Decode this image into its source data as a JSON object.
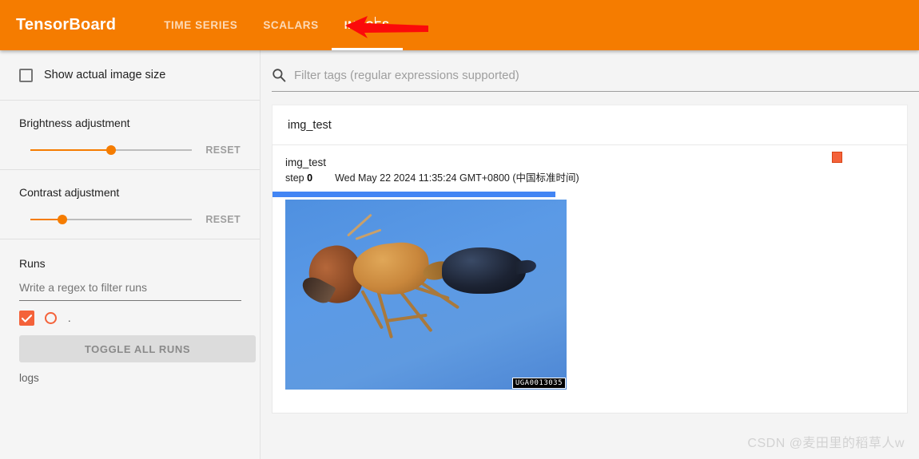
{
  "header": {
    "brand": "TensorBoard",
    "tabs": [
      {
        "label": "TIME SERIES",
        "active": false
      },
      {
        "label": "SCALARS",
        "active": false
      },
      {
        "label": "IMAGES",
        "active": true
      }
    ],
    "annotation": "red-left-arrow",
    "background_color": "#f57c00"
  },
  "sidebar": {
    "show_actual_image_size": {
      "label": "Show actual image size",
      "checked": false
    },
    "brightness": {
      "title": "Brightness adjustment",
      "reset_label": "RESET",
      "value_percent": 50
    },
    "contrast": {
      "title": "Contrast adjustment",
      "reset_label": "RESET",
      "value_percent": 20
    },
    "runs": {
      "title": "Runs",
      "filter_placeholder": "Write a regex to filter runs",
      "filter_value": "",
      "run_items": [
        {
          "label": ".",
          "checked": true,
          "color": "#f4623a"
        }
      ],
      "toggle_all_label": "TOGGLE ALL RUNS",
      "footer_label": "logs"
    }
  },
  "main": {
    "search": {
      "placeholder": "Filter tags (regular expressions supported)",
      "value": "",
      "icon": "search-icon"
    },
    "tag_group": {
      "title": "img_test"
    },
    "image_card": {
      "title": "img_test",
      "step_label": "step",
      "step_value": "0",
      "timestamp": "Wed May 22 2024 11:35:24 GMT+0800 (中国标准时间)",
      "run_color": "#f4623a",
      "step_slider_percent": 100,
      "image_watermark": "UGA0013035",
      "image_alt": "macro photo of an ant on a blue background"
    }
  },
  "footer": {
    "credit": "CSDN @麦田里的稻草人w"
  }
}
